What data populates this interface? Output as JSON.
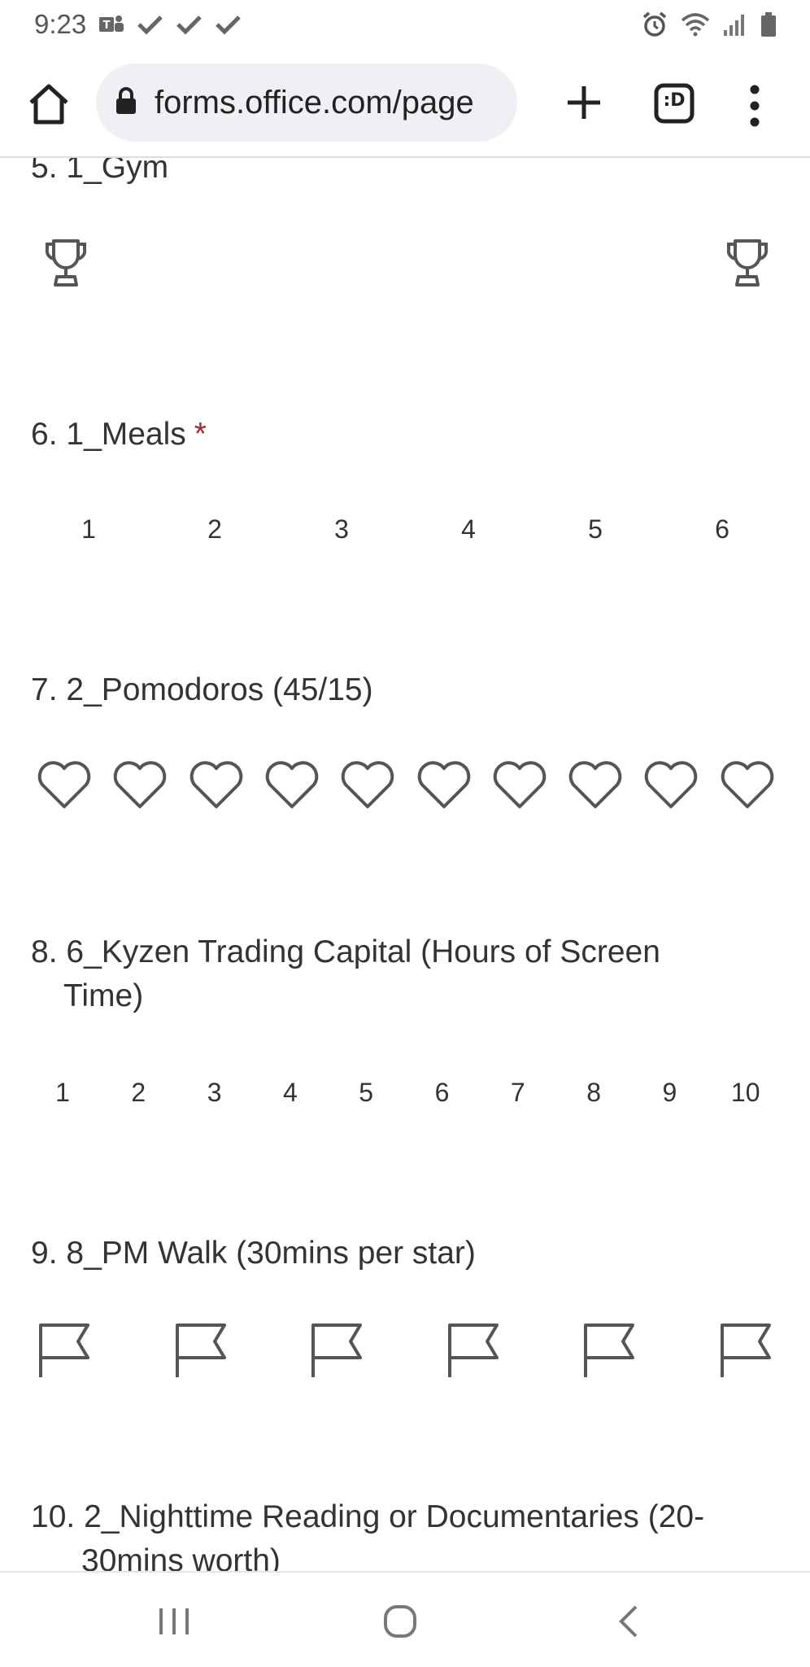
{
  "status_bar": {
    "time": "9:23",
    "left_icons": [
      "teams-icon",
      "check-icon",
      "check-icon",
      "check-icon"
    ],
    "right_icons": [
      "alarm-icon",
      "wifi-icon",
      "signal-icon",
      "battery-icon"
    ]
  },
  "browser": {
    "url": "forms.office.com/page",
    "tab_switcher_label": ":D"
  },
  "questions": [
    {
      "number": "5.",
      "title": "1_Gym",
      "type": "trophy",
      "count": 2,
      "required": false
    },
    {
      "number": "6.",
      "title": "1_Meals",
      "type": "numbers",
      "options": [
        "1",
        "2",
        "3",
        "4",
        "5",
        "6"
      ],
      "required": true,
      "required_mark": "*"
    },
    {
      "number": "7.",
      "title": "2_Pomodoros (45/15)",
      "type": "heart",
      "count": 10,
      "required": false
    },
    {
      "number": "8.",
      "title": "6_Kyzen Trading Capital (Hours of Screen",
      "title_line2": "Time)",
      "type": "numbers",
      "options": [
        "1",
        "2",
        "3",
        "4",
        "5",
        "6",
        "7",
        "8",
        "9",
        "10"
      ],
      "required": false
    },
    {
      "number": "9.",
      "title": "8_PM Walk (30mins per star)",
      "type": "flag",
      "count": 6,
      "required": false
    },
    {
      "number": "10.",
      "title": "2_Nighttime Reading or Documentaries (20-",
      "title_line2": "30mins worth)",
      "required": false
    }
  ],
  "colors": {
    "text": "#333333",
    "icon_stroke": "#555555",
    "required": "#a4262c",
    "urlbar_bg": "#eef0f3"
  }
}
